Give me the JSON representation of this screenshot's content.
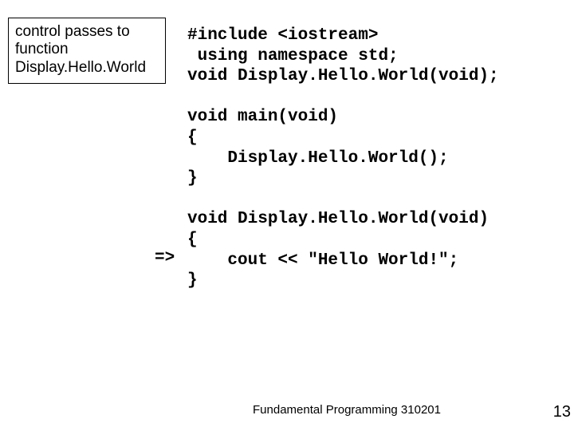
{
  "annotation": {
    "text": "control passes to function Display.Hello.World"
  },
  "arrow": "=>",
  "code": "#include <iostream>\n using namespace std;\nvoid Display.Hello.World(void);\n\nvoid main(void)\n{\n    Display.Hello.World();\n}\n\nvoid Display.Hello.World(void)\n{\n    cout << \"Hello World!\";\n}",
  "footer": "Fundamental Programming 310201",
  "page_number": "13"
}
